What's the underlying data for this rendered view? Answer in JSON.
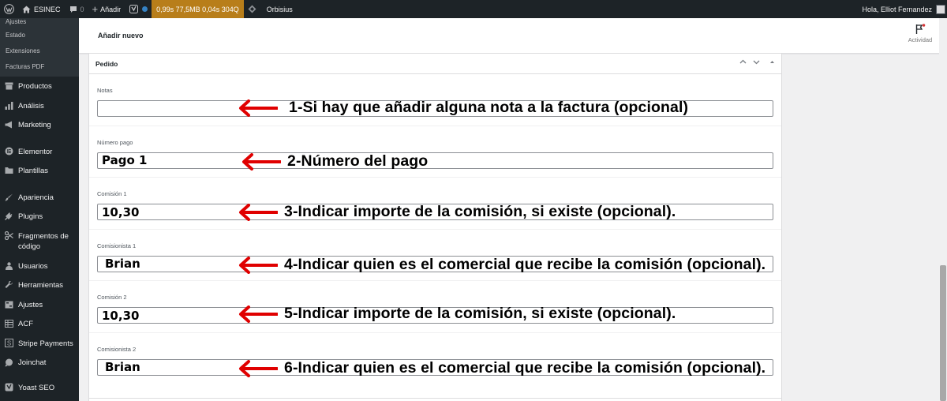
{
  "admin_bar": {
    "site_name": "ESINEC",
    "comments_count": "0",
    "new_label": "Añadir",
    "perf_stats": "0,99s 77,5MB 0,04s 304Q",
    "plugin_label": "Orbisius",
    "greeting": "Hola, Elliot Fernandez"
  },
  "sidebar": {
    "submenu": [
      {
        "label": "Ajustes"
      },
      {
        "label": "Estado"
      },
      {
        "label": "Extensiones"
      },
      {
        "label": "Facturas PDF"
      }
    ],
    "items": [
      {
        "label": "Productos",
        "icon": "archive-icon"
      },
      {
        "label": "Análisis",
        "icon": "bar-chart-icon"
      },
      {
        "label": "Marketing",
        "icon": "megaphone-icon"
      },
      {
        "label": "Elementor",
        "icon": "elementor-icon"
      },
      {
        "label": "Plantillas",
        "icon": "folder-icon"
      },
      {
        "label": "Apariencia",
        "icon": "brush-icon"
      },
      {
        "label": "Plugins",
        "icon": "plug-icon"
      },
      {
        "label": "Fragmentos de código",
        "icon": "scissors-icon"
      },
      {
        "label": "Usuarios",
        "icon": "user-icon"
      },
      {
        "label": "Herramientas",
        "icon": "wrench-icon"
      },
      {
        "label": "Ajustes",
        "icon": "sliders-icon"
      },
      {
        "label": "ACF",
        "icon": "grid-icon"
      },
      {
        "label": "Stripe Payments",
        "icon": "stripe-icon"
      },
      {
        "label": "Joinchat",
        "icon": "chat-icon"
      },
      {
        "label": "Yoast SEO",
        "icon": "yoast-icon"
      }
    ]
  },
  "page": {
    "title": "Añadir nuevo",
    "activity_label": "Actividad"
  },
  "metabox": {
    "title": "Pedido",
    "fields": [
      {
        "label": "Notas",
        "value": ""
      },
      {
        "label": "Número pago",
        "value": "Pago 1"
      },
      {
        "label": "Comisión 1",
        "value": "10,30"
      },
      {
        "label": "Comisionista 1",
        "value": "Brian"
      },
      {
        "label": "Comisión 2",
        "value": "10,30"
      },
      {
        "label": "Comisionista 2",
        "value": "Brian"
      }
    ]
  },
  "annotations": [
    "1-Si hay que añadir alguna nota a la factura (opcional)",
    "2-Número del pago",
    "3-Indicar importe de la comisión, si existe (opcional).",
    "4-Indicar quien es el comercial que recibe la comisión (opcional).",
    "5-Indicar importe de la comisión, si existe (opcional).",
    "6-Indicar quien es el comercial que recibe la comisión (opcional)."
  ],
  "colors": {
    "admin_bar": "#1d2327",
    "perf_badge": "#b87e1a",
    "arrow": "#e00000",
    "notice_dot": "#d63638"
  }
}
